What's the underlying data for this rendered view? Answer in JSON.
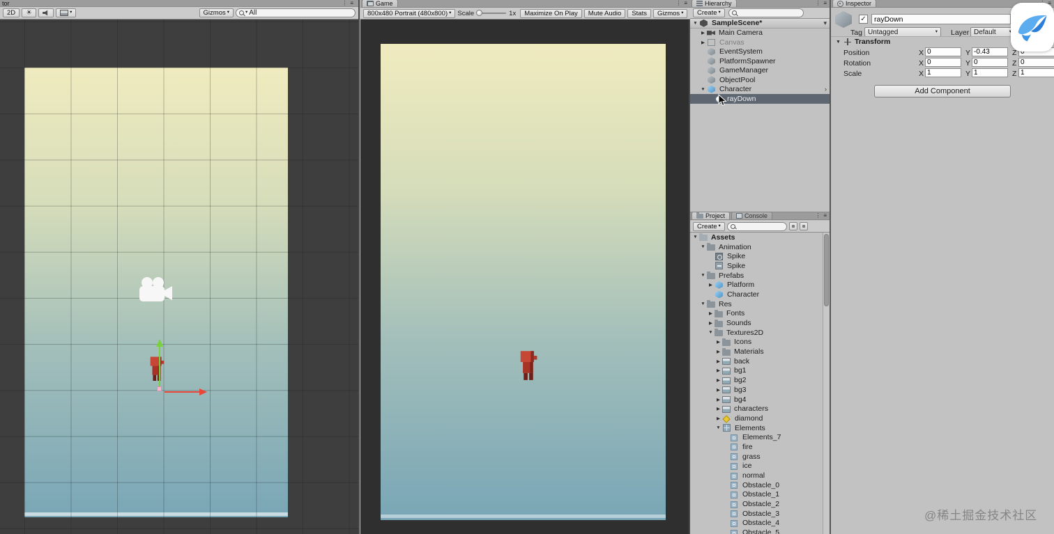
{
  "icons": {
    "dropdown_caret": "▾",
    "pane_menu": "≡",
    "pane_dots": "⋮",
    "expander_expanded": "▼",
    "expander_collapsed": "▶",
    "checkmark": "✓",
    "prefab_chevron": "›",
    "sun": "☀"
  },
  "scene_panel": {
    "titlebar_text": "tor",
    "toolbar": {
      "mode_2d": "2D",
      "gizmos_label": "Gizmos",
      "search_value": "All"
    }
  },
  "game_panel": {
    "tab_label": "Game",
    "toolbar": {
      "aspect_value": "800x480 Portrait (480x800)",
      "scale_label": "Scale",
      "scale_value": "1x",
      "maximize_label": "Maximize On Play",
      "mute_label": "Mute Audio",
      "stats_label": "Stats",
      "gizmos_label": "Gizmos"
    }
  },
  "hierarchy_panel": {
    "tab_label": "Hierarchy",
    "create_label": "Create",
    "items": [
      {
        "label": "SampleScene*",
        "icon": "unity-scene",
        "indent": 0,
        "arrow": "down",
        "bold": true,
        "header": true,
        "trailing": "caret"
      },
      {
        "label": "Main Camera",
        "icon": "camera",
        "indent": 1,
        "arrow": "right"
      },
      {
        "label": "Canvas",
        "icon": "canvas",
        "indent": 1,
        "arrow": "right",
        "muted": true
      },
      {
        "label": "EventSystem",
        "icon": "gameobject",
        "indent": 1
      },
      {
        "label": "PlatformSpawner",
        "icon": "gameobject",
        "indent": 1
      },
      {
        "label": "GameManager",
        "icon": "gameobject",
        "indent": 1
      },
      {
        "label": "ObjectPool",
        "icon": "gameobject",
        "indent": 1
      },
      {
        "label": "Character",
        "icon": "prefab",
        "indent": 1,
        "arrow": "down",
        "trailing": "chevron"
      },
      {
        "label": "rayDown",
        "icon": "effect",
        "indent": 2,
        "selected": true
      }
    ]
  },
  "project_panel": {
    "tabs": [
      "Project",
      "Console"
    ],
    "create_label": "Create",
    "items": [
      {
        "label": "Assets",
        "icon": "folder-open",
        "indent": 0,
        "arrow": "down",
        "bold": true
      },
      {
        "label": "Animation",
        "icon": "folder",
        "indent": 1,
        "arrow": "down"
      },
      {
        "label": "Spike",
        "icon": "animator",
        "indent": 2
      },
      {
        "label": "Spike",
        "icon": "anim-clip",
        "indent": 2
      },
      {
        "label": "Prefabs",
        "icon": "folder",
        "indent": 1,
        "arrow": "down"
      },
      {
        "label": "Platform",
        "icon": "prefab",
        "indent": 2,
        "arrow": "right"
      },
      {
        "label": "Character",
        "icon": "prefab",
        "indent": 2
      },
      {
        "label": "Res",
        "icon": "folder",
        "indent": 1,
        "arrow": "down"
      },
      {
        "label": "Fonts",
        "icon": "folder",
        "indent": 2,
        "arrow": "right"
      },
      {
        "label": "Sounds",
        "icon": "folder",
        "indent": 2,
        "arrow": "right"
      },
      {
        "label": "Textures2D",
        "icon": "folder",
        "indent": 2,
        "arrow": "down"
      },
      {
        "label": "Icons",
        "icon": "folder",
        "indent": 3,
        "arrow": "right"
      },
      {
        "label": "Materials",
        "icon": "folder",
        "indent": 3,
        "arrow": "right"
      },
      {
        "label": "back",
        "icon": "texture",
        "indent": 3,
        "arrow": "right"
      },
      {
        "label": "bg1",
        "icon": "texture",
        "indent": 3,
        "arrow": "right"
      },
      {
        "label": "bg2",
        "icon": "texture",
        "indent": 3,
        "arrow": "right"
      },
      {
        "label": "bg3",
        "icon": "texture",
        "indent": 3,
        "arrow": "right"
      },
      {
        "label": "bg4",
        "icon": "texture",
        "indent": 3,
        "arrow": "right"
      },
      {
        "label": "characters",
        "icon": "texture",
        "indent": 3,
        "arrow": "right"
      },
      {
        "label": "diamond",
        "icon": "diamond",
        "indent": 3,
        "arrow": "right"
      },
      {
        "label": "Elements",
        "icon": "elements",
        "indent": 3,
        "arrow": "down"
      },
      {
        "label": "Elements_7",
        "icon": "texture-small",
        "indent": 4
      },
      {
        "label": "fire",
        "icon": "texture-small",
        "indent": 4
      },
      {
        "label": "grass",
        "icon": "texture-small",
        "indent": 4
      },
      {
        "label": "ice",
        "icon": "texture-small",
        "indent": 4
      },
      {
        "label": "normal",
        "icon": "texture-small",
        "indent": 4
      },
      {
        "label": "Obstacle_0",
        "icon": "texture-small",
        "indent": 4
      },
      {
        "label": "Obstacle_1",
        "icon": "texture-small",
        "indent": 4
      },
      {
        "label": "Obstacle_2",
        "icon": "texture-small",
        "indent": 4
      },
      {
        "label": "Obstacle_3",
        "icon": "texture-small",
        "indent": 4
      },
      {
        "label": "Obstacle_4",
        "icon": "texture-small",
        "indent": 4
      },
      {
        "label": "Obstacle_5",
        "icon": "texture-small",
        "indent": 4
      }
    ]
  },
  "inspector_panel": {
    "tab_label": "Inspector",
    "name_value": "rayDown",
    "tag_label": "Tag",
    "tag_value": "Untagged",
    "layer_label": "Layer",
    "layer_value": "Default",
    "transform": {
      "title": "Transform",
      "axis_labels": [
        "X",
        "Y",
        "Z"
      ],
      "rows": [
        {
          "label": "Position",
          "x": "0",
          "y": "-0.43",
          "z": "0"
        },
        {
          "label": "Rotation",
          "x": "0",
          "y": "0",
          "z": "0"
        },
        {
          "label": "Scale",
          "x": "1",
          "y": "1",
          "z": "1"
        }
      ]
    },
    "add_component_label": "Add Component"
  },
  "watermark": "@稀土掘金技术社区",
  "colors": {
    "selection": "#5d6671",
    "gradient_top": "#f0ebbf",
    "gradient_bottom": "#79a6b6",
    "scene_bg": "#3e3e3e",
    "game_bg": "#2f2f2f"
  }
}
